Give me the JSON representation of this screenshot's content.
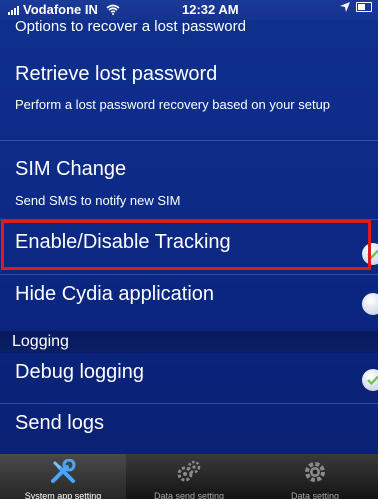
{
  "status_bar": {
    "carrier": "Vodafone IN",
    "time": "12:32 AM"
  },
  "header": {
    "partial_text": "Options to recover a lost password"
  },
  "settings": {
    "retrieve_password": {
      "title": "Retrieve lost password",
      "description": "Perform a lost password recovery based on your setup"
    },
    "sim_change": {
      "title": "SIM Change",
      "description": "Send SMS to notify new SIM"
    },
    "tracking": {
      "title": "Enable/Disable Tracking",
      "enabled": true
    },
    "hide_cydia": {
      "title": "Hide Cydia application",
      "enabled": false
    }
  },
  "logging_section": {
    "header": "Logging",
    "debug_logging": {
      "title": "Debug logging",
      "enabled": true
    },
    "send_logs": {
      "title": "Send logs"
    }
  },
  "tab_bar": {
    "tabs": [
      {
        "label": "System app setting",
        "icon": "wrench-screwdriver-icon",
        "active": true
      },
      {
        "label": "Data send setting",
        "icon": "gears-icon",
        "active": false
      },
      {
        "label": "Data setting",
        "icon": "gear-icon",
        "active": false
      }
    ]
  },
  "colors": {
    "background": "#0c2a86",
    "highlight": "#e11a1a",
    "check": "#6cc04a"
  }
}
